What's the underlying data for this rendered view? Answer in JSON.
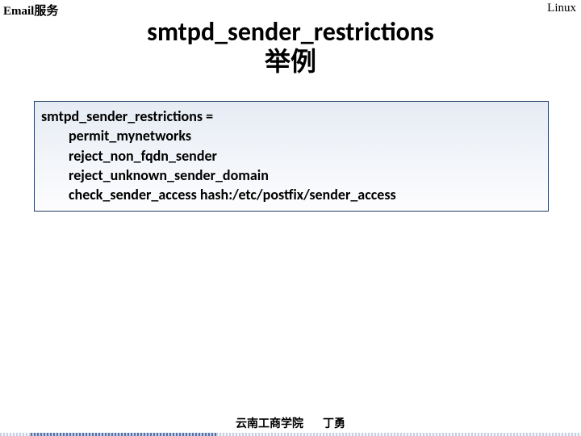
{
  "header": {
    "left": "Email服务",
    "right": "Linux"
  },
  "title": {
    "line1": "smtpd_sender_restrictions",
    "line2": "举例"
  },
  "config": {
    "lead": "smtpd_sender_restrictions =",
    "entries": [
      "permit_mynetworks",
      "reject_non_fqdn_sender",
      "reject_unknown_sender_domain",
      "check_sender_access hash:/etc/postfix/sender_access"
    ]
  },
  "footer": {
    "org": "云南工商学院",
    "author": "丁勇"
  }
}
